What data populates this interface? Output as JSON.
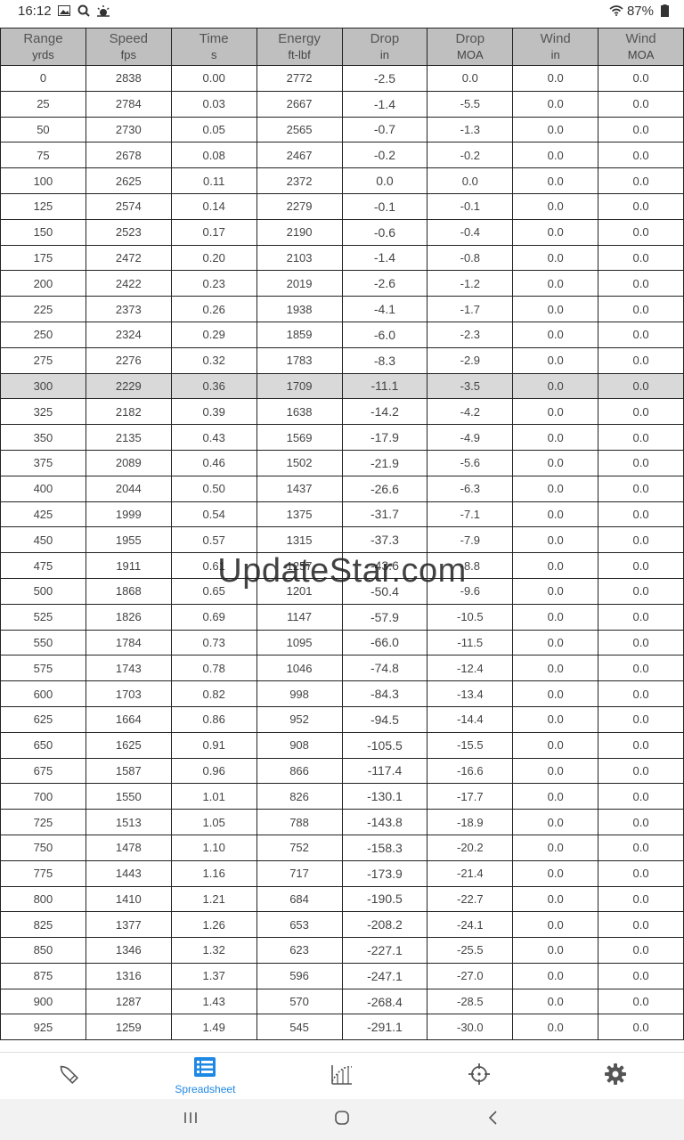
{
  "status": {
    "time": "16:12",
    "battery": "87%"
  },
  "table": {
    "headers": [
      {
        "label": "Range",
        "unit": "yrds"
      },
      {
        "label": "Speed",
        "unit": "fps"
      },
      {
        "label": "Time",
        "unit": "s"
      },
      {
        "label": "Energy",
        "unit": "ft-lbf"
      },
      {
        "label": "Drop",
        "unit": "in"
      },
      {
        "label": "Drop",
        "unit": "MOA"
      },
      {
        "label": "Wind",
        "unit": "in"
      },
      {
        "label": "Wind",
        "unit": "MOA"
      }
    ],
    "selected_range": "300",
    "rows": [
      [
        "0",
        "2838",
        "0.00",
        "2772",
        "-2.5",
        "0.0",
        "0.0",
        "0.0"
      ],
      [
        "25",
        "2784",
        "0.03",
        "2667",
        "-1.4",
        "-5.5",
        "0.0",
        "0.0"
      ],
      [
        "50",
        "2730",
        "0.05",
        "2565",
        "-0.7",
        "-1.3",
        "0.0",
        "0.0"
      ],
      [
        "75",
        "2678",
        "0.08",
        "2467",
        "-0.2",
        "-0.2",
        "0.0",
        "0.0"
      ],
      [
        "100",
        "2625",
        "0.11",
        "2372",
        "0.0",
        "0.0",
        "0.0",
        "0.0"
      ],
      [
        "125",
        "2574",
        "0.14",
        "2279",
        "-0.1",
        "-0.1",
        "0.0",
        "0.0"
      ],
      [
        "150",
        "2523",
        "0.17",
        "2190",
        "-0.6",
        "-0.4",
        "0.0",
        "0.0"
      ],
      [
        "175",
        "2472",
        "0.20",
        "2103",
        "-1.4",
        "-0.8",
        "0.0",
        "0.0"
      ],
      [
        "200",
        "2422",
        "0.23",
        "2019",
        "-2.6",
        "-1.2",
        "0.0",
        "0.0"
      ],
      [
        "225",
        "2373",
        "0.26",
        "1938",
        "-4.1",
        "-1.7",
        "0.0",
        "0.0"
      ],
      [
        "250",
        "2324",
        "0.29",
        "1859",
        "-6.0",
        "-2.3",
        "0.0",
        "0.0"
      ],
      [
        "275",
        "2276",
        "0.32",
        "1783",
        "-8.3",
        "-2.9",
        "0.0",
        "0.0"
      ],
      [
        "300",
        "2229",
        "0.36",
        "1709",
        "-11.1",
        "-3.5",
        "0.0",
        "0.0"
      ],
      [
        "325",
        "2182",
        "0.39",
        "1638",
        "-14.2",
        "-4.2",
        "0.0",
        "0.0"
      ],
      [
        "350",
        "2135",
        "0.43",
        "1569",
        "-17.9",
        "-4.9",
        "0.0",
        "0.0"
      ],
      [
        "375",
        "2089",
        "0.46",
        "1502",
        "-21.9",
        "-5.6",
        "0.0",
        "0.0"
      ],
      [
        "400",
        "2044",
        "0.50",
        "1437",
        "-26.6",
        "-6.3",
        "0.0",
        "0.0"
      ],
      [
        "425",
        "1999",
        "0.54",
        "1375",
        "-31.7",
        "-7.1",
        "0.0",
        "0.0"
      ],
      [
        "450",
        "1955",
        "0.57",
        "1315",
        "-37.3",
        "-7.9",
        "0.0",
        "0.0"
      ],
      [
        "475",
        "1911",
        "0.61",
        "1257",
        "-43.6",
        "-8.8",
        "0.0",
        "0.0"
      ],
      [
        "500",
        "1868",
        "0.65",
        "1201",
        "-50.4",
        "-9.6",
        "0.0",
        "0.0"
      ],
      [
        "525",
        "1826",
        "0.69",
        "1147",
        "-57.9",
        "-10.5",
        "0.0",
        "0.0"
      ],
      [
        "550",
        "1784",
        "0.73",
        "1095",
        "-66.0",
        "-11.5",
        "0.0",
        "0.0"
      ],
      [
        "575",
        "1743",
        "0.78",
        "1046",
        "-74.8",
        "-12.4",
        "0.0",
        "0.0"
      ],
      [
        "600",
        "1703",
        "0.82",
        "998",
        "-84.3",
        "-13.4",
        "0.0",
        "0.0"
      ],
      [
        "625",
        "1664",
        "0.86",
        "952",
        "-94.5",
        "-14.4",
        "0.0",
        "0.0"
      ],
      [
        "650",
        "1625",
        "0.91",
        "908",
        "-105.5",
        "-15.5",
        "0.0",
        "0.0"
      ],
      [
        "675",
        "1587",
        "0.96",
        "866",
        "-117.4",
        "-16.6",
        "0.0",
        "0.0"
      ],
      [
        "700",
        "1550",
        "1.01",
        "826",
        "-130.1",
        "-17.7",
        "0.0",
        "0.0"
      ],
      [
        "725",
        "1513",
        "1.05",
        "788",
        "-143.8",
        "-18.9",
        "0.0",
        "0.0"
      ],
      [
        "750",
        "1478",
        "1.10",
        "752",
        "-158.3",
        "-20.2",
        "0.0",
        "0.0"
      ],
      [
        "775",
        "1443",
        "1.16",
        "717",
        "-173.9",
        "-21.4",
        "0.0",
        "0.0"
      ],
      [
        "800",
        "1410",
        "1.21",
        "684",
        "-190.5",
        "-22.7",
        "0.0",
        "0.0"
      ],
      [
        "825",
        "1377",
        "1.26",
        "653",
        "-208.2",
        "-24.1",
        "0.0",
        "0.0"
      ],
      [
        "850",
        "1346",
        "1.32",
        "623",
        "-227.1",
        "-25.5",
        "0.0",
        "0.0"
      ],
      [
        "875",
        "1316",
        "1.37",
        "596",
        "-247.1",
        "-27.0",
        "0.0",
        "0.0"
      ],
      [
        "900",
        "1287",
        "1.43",
        "570",
        "-268.4",
        "-28.5",
        "0.0",
        "0.0"
      ],
      [
        "925",
        "1259",
        "1.49",
        "545",
        "-291.1",
        "-30.0",
        "0.0",
        "0.0"
      ]
    ]
  },
  "watermark": "UpdateStar.com",
  "bottom_nav": {
    "items": [
      {
        "id": "rifle",
        "icon": "bullet-icon",
        "label": ""
      },
      {
        "id": "spreadsheet",
        "icon": "spreadsheet-icon",
        "label": "Spreadsheet",
        "active": true
      },
      {
        "id": "trajectory",
        "icon": "trajectory-chart-icon",
        "label": ""
      },
      {
        "id": "target",
        "icon": "crosshair-icon",
        "label": ""
      },
      {
        "id": "settings",
        "icon": "gear-icon",
        "label": ""
      }
    ],
    "active_color": "#1e88e5"
  },
  "system_nav": {
    "icons": [
      "recent-apps-icon",
      "home-icon",
      "back-icon"
    ]
  }
}
